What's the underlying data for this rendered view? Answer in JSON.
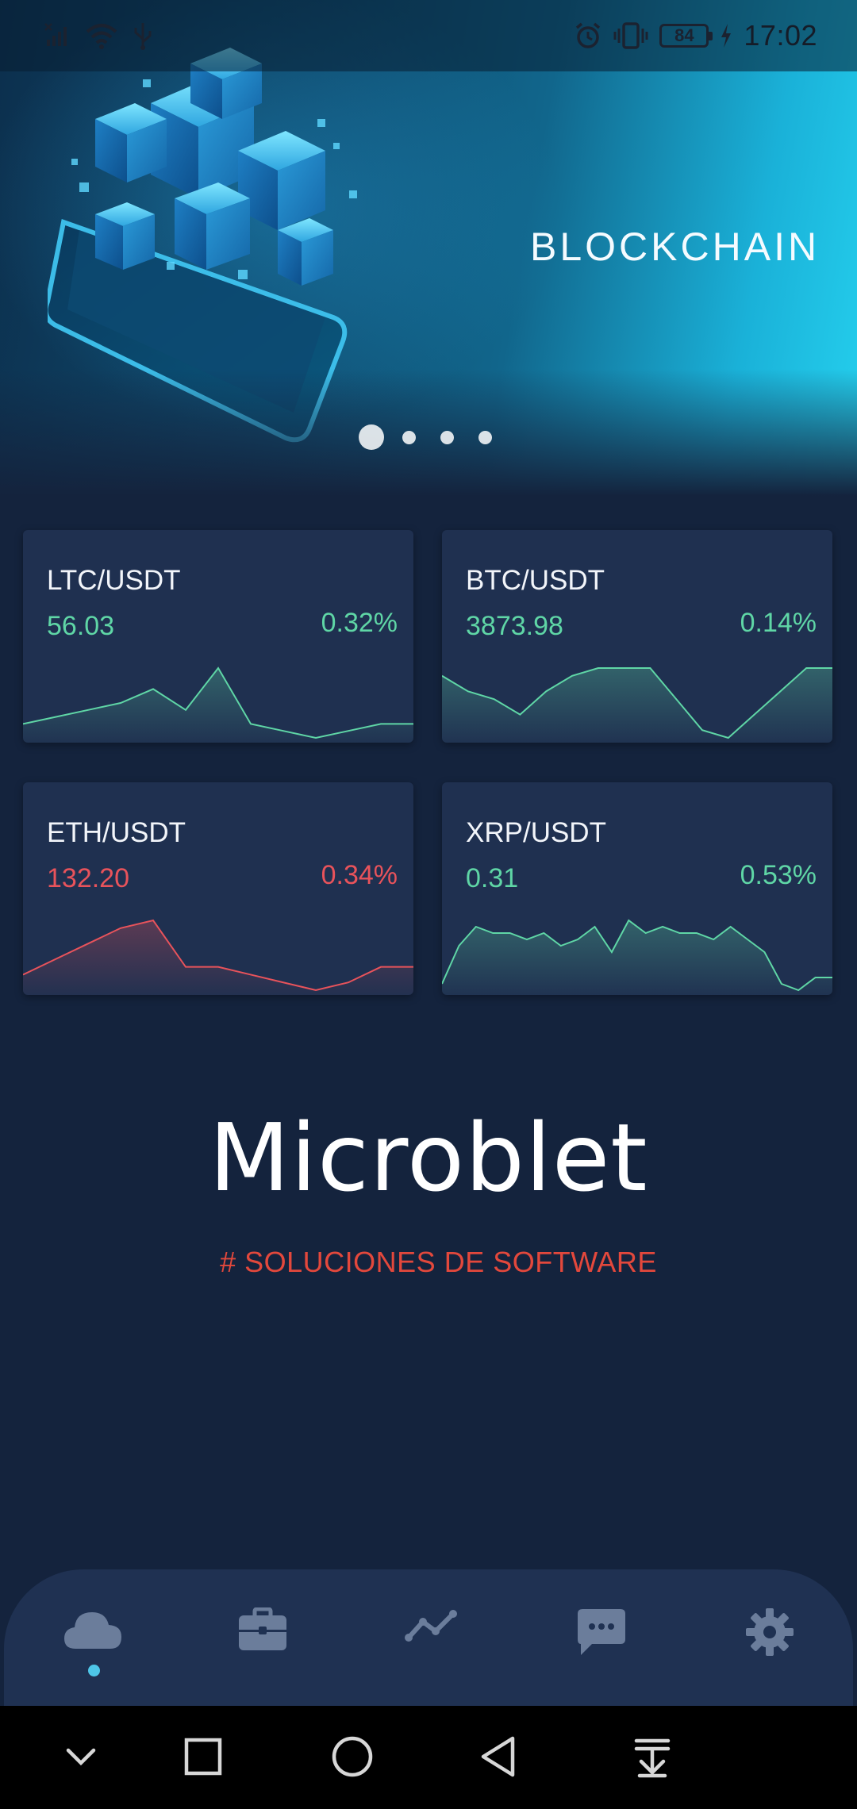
{
  "status_bar": {
    "time": "17:02",
    "battery": "84",
    "left_icons": [
      "no-sim-icon",
      "wifi-icon",
      "usb-icon"
    ],
    "right_icons": [
      "alarm-icon",
      "vibrate-icon",
      "battery-icon",
      "charging-icon"
    ]
  },
  "banner": {
    "title": "BLOCKCHAIN",
    "slide_count": 4,
    "active_slide": 1
  },
  "tickers": [
    {
      "pair": "LTC/USDT",
      "price": "56.03",
      "change": "0.32%",
      "trend": "up",
      "spark": [
        3,
        4,
        5,
        6,
        8,
        5,
        11,
        3,
        2,
        1,
        2,
        3,
        3
      ]
    },
    {
      "pair": "BTC/USDT",
      "price": "3873.98",
      "change": "0.14%",
      "trend": "up",
      "spark": [
        9,
        7,
        6,
        4,
        7,
        9,
        10,
        10,
        10,
        6,
        2,
        1,
        4,
        7,
        10,
        10
      ]
    },
    {
      "pair": "ETH/USDT",
      "price": "132.20",
      "change": "0.34%",
      "trend": "down",
      "spark": [
        4,
        6,
        8,
        10,
        11,
        5,
        5,
        4,
        3,
        2,
        3,
        5,
        5
      ]
    },
    {
      "pair": "XRP/USDT",
      "price": "0.31",
      "change": "0.53%",
      "trend": "up",
      "spark": [
        2,
        8,
        11,
        10,
        10,
        9,
        10,
        8,
        9,
        11,
        7,
        12,
        10,
        11,
        10,
        10,
        9,
        11,
        9,
        7,
        2,
        1,
        3,
        3
      ]
    }
  ],
  "brand": {
    "name": "Microblet",
    "tagline": "# SOLUCIONES DE SOFTWARE"
  },
  "nav": {
    "items": [
      "cloud-icon",
      "briefcase-icon",
      "chart-line-icon",
      "chat-icon",
      "gear-icon"
    ],
    "active": 0
  },
  "system_nav": [
    "hide-icon",
    "recents-icon",
    "home-icon",
    "back-icon",
    "notifications-icon"
  ],
  "colors": {
    "background": "#14233d",
    "card": "#1f3050",
    "up": "#5fd6a6",
    "down": "#e8535b",
    "accent": "#4ec6e8",
    "tagline": "#e3483c"
  }
}
